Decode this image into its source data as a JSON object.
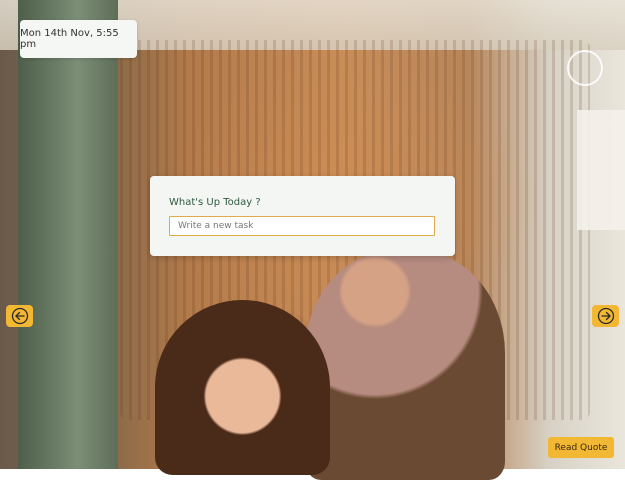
{
  "clock": {
    "datetime": "Mon 14th Nov, 5:55 pm"
  },
  "task": {
    "title": "What's Up Today ?",
    "input_placeholder": "Write a new task",
    "input_value": ""
  },
  "nav": {
    "prev_icon": "arrow-left-circle-icon",
    "next_icon": "arrow-right-circle-icon"
  },
  "quote": {
    "button_label": "Read Quote"
  },
  "colors": {
    "accent": "#f2b733",
    "card": "#f4f6f4",
    "title": "#2f5a3e",
    "input_border": "#e0a94a"
  }
}
